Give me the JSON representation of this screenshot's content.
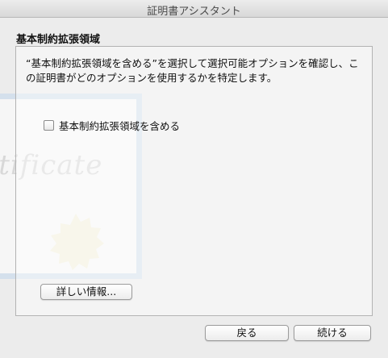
{
  "window": {
    "title": "証明書アシスタント"
  },
  "heading": "基本制約拡張領域",
  "description": "“基本制約拡張領域を含める”を選択して選択可能オプションを確認し、この証明書がどのオプションを使用するかを特定します。",
  "checkbox": {
    "label": "基本制約拡張領域を含める",
    "checked": false
  },
  "background_art": {
    "script_text": "rtificate"
  },
  "buttons": {
    "more_info": "詳しい情報...",
    "back": "戻る",
    "continue": "続ける"
  }
}
